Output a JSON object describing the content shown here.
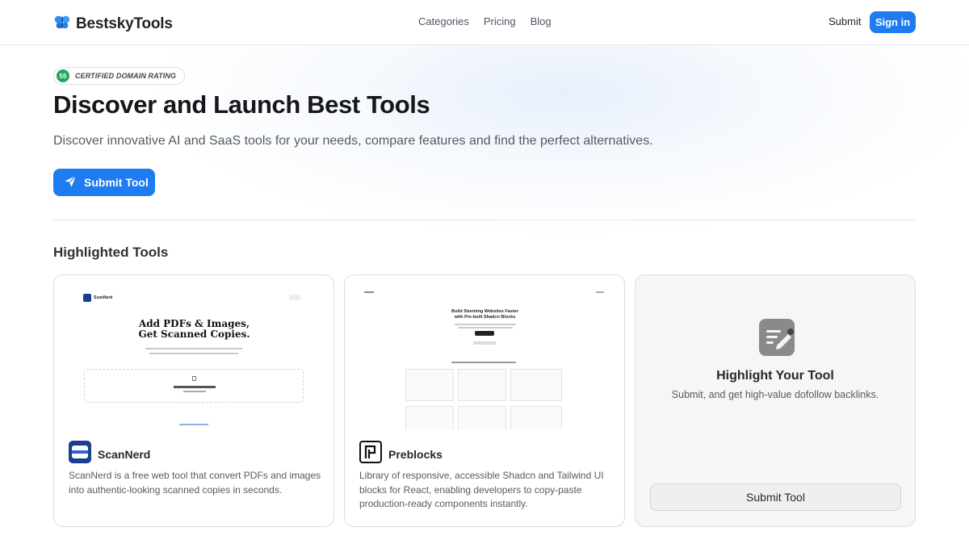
{
  "header": {
    "brand": "BestskyTools",
    "nav": [
      "Categories",
      "Pricing",
      "Blog"
    ],
    "submit_label": "Submit",
    "signin_label": "Sign in"
  },
  "hero": {
    "badge_number": "55",
    "badge_text": "CERTIFIED DOMAIN RATING",
    "title": "Discover and Launch Best Tools",
    "subtitle": "Discover innovative AI and SaaS tools for your needs, compare features and find the perfect alternatives.",
    "cta_label": "Submit Tool"
  },
  "highlighted": {
    "heading": "Highlighted Tools",
    "cards": [
      {
        "name": "ScanNerd",
        "description": "ScanNerd is a free web tool that convert PDFs and images into authentic-looking scanned copies in seconds.",
        "preview": {
          "brand": "ScanNerd",
          "headline_1": "Add PDFs & Images,",
          "headline_2": "Get Scanned Copies."
        }
      },
      {
        "name": "Preblocks",
        "description": "Library of responsive, accessible Shadcn and Tailwind UI blocks for React, enabling developers to copy-paste production-ready components instantly.",
        "preview": {
          "headline_1": "Build Stunning Websites Faster",
          "headline_2": "with Pre-built Shadcn Blocks"
        }
      }
    ],
    "cta_card": {
      "title": "Highlight Your Tool",
      "description": "Submit, and get high-value dofollow backlinks.",
      "button_label": "Submit Tool"
    }
  },
  "colors": {
    "accent": "#1e7bf0",
    "badge_green": "#22a559"
  },
  "icons": {
    "logo": "butterfly-logo-icon",
    "hero_cta": "paper-plane-icon",
    "cta_card": "edit-note-icon"
  }
}
